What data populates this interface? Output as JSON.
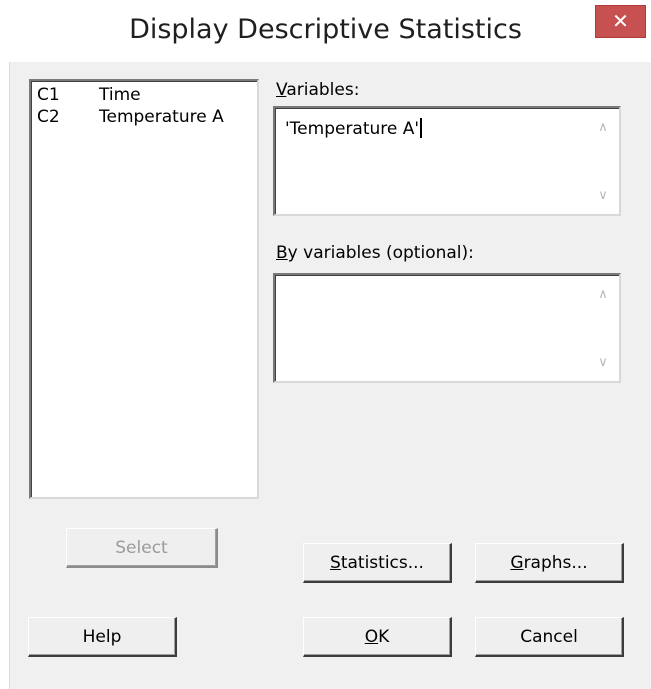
{
  "window": {
    "title": "Display Descriptive Statistics",
    "close_glyph": "✕"
  },
  "columns_list": {
    "items": [
      {
        "col": "C1",
        "name": "Time"
      },
      {
        "col": "C2",
        "name": "Temperature A"
      }
    ]
  },
  "variables": {
    "label_accel": "V",
    "label_rest": "ariables:",
    "value": "'Temperature A'"
  },
  "by_variables": {
    "label_accel": "B",
    "label_rest": "y variables (optional):",
    "value": ""
  },
  "buttons": {
    "select": "Select",
    "statistics_accel": "S",
    "statistics_rest": "tatistics...",
    "graphs_accel": "G",
    "graphs_rest": "raphs...",
    "help": "Help",
    "ok_accel": "O",
    "ok_rest": "K",
    "cancel": "Cancel"
  },
  "icons": {
    "scroll_up": "chevron-up-icon",
    "scroll_down": "chevron-down-icon",
    "close": "close-icon"
  },
  "colors": {
    "close_button": "#c75050",
    "dialog_background": "#f0f0f0"
  }
}
